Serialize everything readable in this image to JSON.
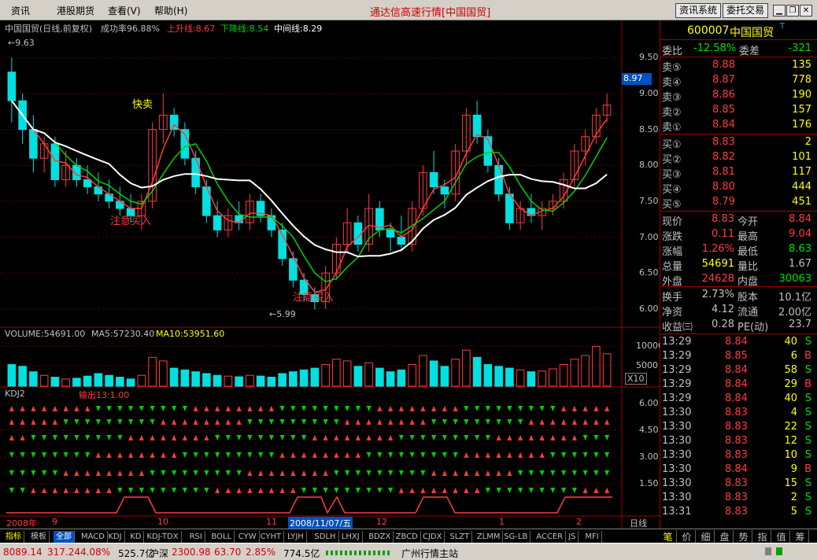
{
  "menu": {
    "items": [
      "资讯",
      "港股期货",
      "查看(V)",
      "帮助(H)"
    ],
    "title": "通达信高速行情[中国国贸]",
    "btn_info": "资讯系统",
    "btn_trade": "委托交易"
  },
  "chart": {
    "title": "中国国贸(日线,前复权)",
    "success_rate": "成功率96.88%",
    "up_line": "上升线:8.67",
    "down_line": "下降线:8.54",
    "mid_line": "中间线:8.29",
    "high_marker": "9.63",
    "low_marker": "5.99",
    "current_price_tag": "8.97",
    "signal_sell": "快卖",
    "signal_buy1": "注意买入",
    "signal_buy2": "注意买入",
    "volume_legend": "VOLUME:54691.00",
    "ma5_legend": "MA5:57230.40",
    "ma10_legend": "MA10:53951.60",
    "kdj_title": "KDJ2",
    "kdj_out": "输出13:1.00",
    "vol_unit": "X10",
    "date_labels": [
      "2008年",
      "9",
      "10",
      "11",
      "2008/11/07/五",
      "12",
      "1",
      "2"
    ],
    "period": "日线"
  },
  "chart_data": {
    "type": "candlestick",
    "ohlc": [
      [
        9.3,
        9.5,
        8.6,
        8.9
      ],
      [
        8.9,
        9.0,
        8.3,
        8.5
      ],
      [
        8.5,
        8.7,
        7.9,
        8.1
      ],
      [
        8.1,
        8.4,
        7.9,
        8.3
      ],
      [
        8.3,
        8.4,
        7.7,
        7.8
      ],
      [
        7.8,
        8.2,
        7.7,
        8.0
      ],
      [
        8.0,
        8.1,
        7.7,
        7.8
      ],
      [
        7.8,
        8.0,
        7.6,
        7.7
      ],
      [
        7.7,
        7.9,
        7.5,
        7.6
      ],
      [
        7.6,
        7.8,
        7.4,
        7.5
      ],
      [
        7.5,
        7.7,
        7.3,
        7.4
      ],
      [
        7.4,
        7.6,
        7.2,
        7.3
      ],
      [
        7.3,
        7.6,
        7.1,
        7.5
      ],
      [
        7.5,
        8.6,
        7.4,
        8.5
      ],
      [
        8.5,
        9.0,
        8.3,
        8.7
      ],
      [
        8.7,
        8.8,
        8.4,
        8.5
      ],
      [
        8.5,
        8.6,
        8.0,
        8.1
      ],
      [
        8.1,
        8.2,
        7.6,
        7.7
      ],
      [
        7.7,
        7.8,
        7.2,
        7.3
      ],
      [
        7.3,
        7.5,
        7.0,
        7.1
      ],
      [
        7.1,
        7.4,
        7.0,
        7.3
      ],
      [
        7.3,
        7.5,
        7.1,
        7.2
      ],
      [
        7.2,
        7.6,
        7.1,
        7.5
      ],
      [
        7.5,
        7.6,
        7.2,
        7.3
      ],
      [
        7.3,
        7.4,
        7.0,
        7.1
      ],
      [
        7.1,
        7.2,
        6.6,
        6.7
      ],
      [
        6.7,
        6.8,
        6.3,
        6.4
      ],
      [
        6.4,
        6.5,
        6.1,
        6.2
      ],
      [
        6.2,
        6.3,
        5.99,
        6.1
      ],
      [
        6.1,
        6.6,
        6.0,
        6.5
      ],
      [
        6.5,
        7.0,
        6.4,
        6.9
      ],
      [
        6.9,
        7.4,
        6.8,
        7.2
      ],
      [
        7.2,
        7.3,
        6.8,
        6.9
      ],
      [
        6.9,
        7.6,
        6.8,
        7.4
      ],
      [
        7.4,
        7.5,
        7.0,
        7.1
      ],
      [
        7.1,
        7.2,
        6.8,
        7.0
      ],
      [
        7.0,
        7.3,
        6.8,
        6.9
      ],
      [
        6.9,
        7.5,
        6.8,
        7.4
      ],
      [
        7.4,
        8.0,
        7.3,
        7.9
      ],
      [
        7.9,
        8.2,
        7.6,
        7.7
      ],
      [
        7.7,
        7.8,
        7.4,
        7.6
      ],
      [
        7.6,
        8.3,
        7.5,
        8.2
      ],
      [
        8.2,
        8.8,
        8.0,
        8.7
      ],
      [
        8.7,
        8.9,
        8.3,
        8.4
      ],
      [
        8.4,
        8.5,
        7.9,
        8.0
      ],
      [
        8.0,
        8.1,
        7.5,
        7.6
      ],
      [
        7.6,
        7.7,
        7.1,
        7.2
      ],
      [
        7.2,
        7.5,
        7.1,
        7.4
      ],
      [
        7.4,
        7.6,
        7.2,
        7.3
      ],
      [
        7.3,
        7.5,
        7.1,
        7.4
      ],
      [
        7.4,
        7.6,
        7.3,
        7.5
      ],
      [
        7.5,
        7.9,
        7.4,
        7.8
      ],
      [
        7.8,
        8.3,
        7.7,
        8.2
      ],
      [
        8.2,
        8.5,
        8.0,
        8.4
      ],
      [
        8.4,
        8.8,
        8.3,
        8.7
      ],
      [
        8.7,
        9.0,
        8.6,
        8.84
      ]
    ],
    "ylim": [
      5.8,
      9.8
    ],
    "y_ticks": [
      9.5,
      9.0,
      8.5,
      8.0,
      7.5,
      7.0,
      6.5,
      6.0
    ],
    "volume_ticks": [
      "10000",
      "5000"
    ],
    "volumes": [
      60,
      55,
      40,
      30,
      25,
      20,
      22,
      28,
      35,
      30,
      25,
      20,
      30,
      80,
      70,
      50,
      45,
      40,
      35,
      30,
      28,
      26,
      30,
      28,
      25,
      35,
      40,
      45,
      50,
      60,
      75,
      70,
      55,
      65,
      50,
      40,
      45,
      60,
      85,
      70,
      55,
      75,
      100,
      80,
      60,
      55,
      50,
      45,
      40,
      42,
      48,
      60,
      75,
      85,
      110,
      90
    ],
    "kdj_ticks": [
      "6.00",
      "4.50",
      "3.00",
      "1.50"
    ]
  },
  "quote": {
    "code": "600007",
    "name": "中国国贸",
    "badge": "T",
    "wb_label": "委比",
    "wb": "-12.58%",
    "wc_label": "委差",
    "wc": "-321",
    "sell": [
      [
        "卖⑤",
        "8.88",
        "135"
      ],
      [
        "卖④",
        "8.87",
        "778"
      ],
      [
        "卖③",
        "8.86",
        "190"
      ],
      [
        "卖②",
        "8.85",
        "157"
      ],
      [
        "卖①",
        "8.84",
        "176"
      ]
    ],
    "buy": [
      [
        "买①",
        "8.83",
        "2"
      ],
      [
        "买②",
        "8.82",
        "101"
      ],
      [
        "买③",
        "8.81",
        "117"
      ],
      [
        "买④",
        "8.80",
        "444"
      ],
      [
        "买⑤",
        "8.79",
        "451"
      ]
    ],
    "stats": [
      [
        "现价",
        "8.83",
        "今开",
        "8.84"
      ],
      [
        "涨跌",
        "0.11",
        "最高",
        "9.04"
      ],
      [
        "涨幅",
        "1.26%",
        "最低",
        "8.63"
      ],
      [
        "总量",
        "54691",
        "量比",
        "1.67"
      ],
      [
        "外盘",
        "24628",
        "内盘",
        "30063"
      ]
    ],
    "stats2": [
      [
        "换手",
        "2.73%",
        "股本",
        "10.1亿"
      ],
      [
        "净资",
        "4.12",
        "流通",
        "2.00亿"
      ],
      [
        "收益㈢",
        "0.28",
        "PE(动)",
        "23.7"
      ]
    ],
    "ticks": [
      [
        "13:29",
        "8.84",
        "40",
        "S"
      ],
      [
        "13:29",
        "8.85",
        "6",
        "B"
      ],
      [
        "13:29",
        "8.84",
        "58",
        "S"
      ],
      [
        "13:29",
        "8.84",
        "29",
        "B"
      ],
      [
        "13:29",
        "8.84",
        "40",
        "S"
      ],
      [
        "13:30",
        "8.83",
        "4",
        "S"
      ],
      [
        "13:30",
        "8.83",
        "22",
        "S"
      ],
      [
        "13:30",
        "8.83",
        "12",
        "S"
      ],
      [
        "13:30",
        "8.83",
        "10",
        "S"
      ],
      [
        "13:30",
        "8.84",
        "9",
        "B"
      ],
      [
        "13:30",
        "8.83",
        "15",
        "S"
      ],
      [
        "13:30",
        "8.83",
        "2",
        "S"
      ],
      [
        "13:31",
        "8.83",
        "5",
        "S"
      ]
    ]
  },
  "tabs": {
    "indicators": [
      "指标",
      "模板",
      "全部",
      "MACD",
      "KDJ",
      "KD",
      "KDJ-TDX",
      "RSI",
      "BOLL",
      "CYW",
      "CYHT",
      "LYJH",
      "SDLH",
      "LHXJ",
      "BDZX",
      "ZBCD",
      "CJDX",
      "SLZT",
      "ZLMM",
      "SG-LB",
      "ACCER",
      "JS",
      "MFI"
    ],
    "right": [
      "笔",
      "价",
      "细",
      "盘",
      "势",
      "指",
      "值",
      "筹"
    ]
  },
  "status": {
    "sh": "8089.14",
    "sh_chg": "317.24",
    "sh_pct": "4.08%",
    "sh_amt": "525.7亿",
    "hs_label": "沪深",
    "hs": "2300.98",
    "hs_chg": "63.70",
    "hs_pct": "2.85%",
    "hs_amt": "774.5亿",
    "server": "广州行情主站"
  },
  "colors": {
    "up": "#ff3c3c",
    "down": "#00e0e0",
    "ma_green": "#00d000",
    "ma_white": "#ffffff",
    "grid": "#a00000"
  }
}
